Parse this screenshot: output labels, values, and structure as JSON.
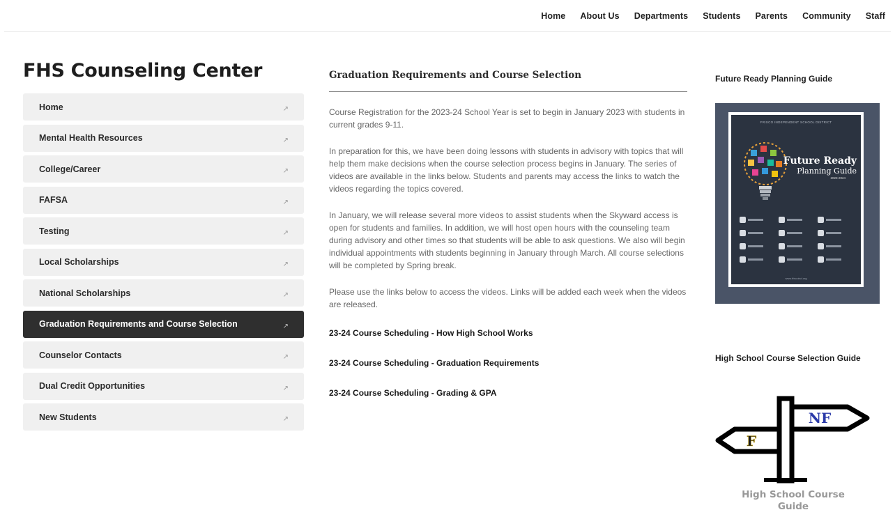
{
  "nav": {
    "items": [
      "Home",
      "About Us",
      "Departments",
      "Students",
      "Parents",
      "Community",
      "Staff"
    ]
  },
  "site": {
    "title": "FHS Counseling Center"
  },
  "sidebar": {
    "active_index": 7,
    "arrow_glyph": "↗",
    "items": [
      {
        "label": "Home"
      },
      {
        "label": "Mental Health Resources"
      },
      {
        "label": "College/Career"
      },
      {
        "label": "FAFSA"
      },
      {
        "label": "Testing"
      },
      {
        "label": "Local Scholarships"
      },
      {
        "label": "National Scholarships"
      },
      {
        "label": "Graduation Requirements and Course Selection"
      },
      {
        "label": "Counselor Contacts"
      },
      {
        "label": "Dual Credit Opportunities"
      },
      {
        "label": "New Students"
      }
    ]
  },
  "main": {
    "heading": "Graduation Requirements and Course Selection",
    "paragraphs": [
      "Course Registration for the 2023-24 School Year is set to begin in January 2023 with students in current grades 9-11.",
      "In preparation for this, we have been doing lessons with students in advisory with topics that will help them make decisions when the course selection process begins in January.  The series of videos are available in the links below.  Students and parents may access the links to watch the videos regarding the topics covered.",
      "In January, we will release several more videos to assist students when the Skyward access is open for students and families.  In addition, we will host open hours with the counseling team during advisory and other times so that students will be able to ask questions.  We also will begin individual appointments with students beginning in January through March.  All course selections will be completed by Spring break.",
      "Please use the links below to access the videos.  Links will be added each week when the videos are released."
    ],
    "links": [
      "23-24 Course Scheduling - How High School Works",
      "23-24 Course Scheduling - Graduation Requirements",
      "23-24 Course Scheduling - Grading & GPA"
    ]
  },
  "right": {
    "future_ready": {
      "heading": "Future Ready Planning Guide",
      "cover": {
        "district": "FRISCO INDEPENDENT SCHOOL DISTRICT",
        "title_line1": "Future Ready",
        "title_line2": "Planning Guide",
        "years": "2023-2024",
        "footer": "www.friscoisd.org"
      }
    },
    "course_guide": {
      "heading": "High School Course Selection Guide",
      "sign_left": "F",
      "sign_right": "NF",
      "caption_line1": "High School Course",
      "caption_line2": "Guide"
    }
  },
  "colors": {
    "active_bg": "#2f2f2f",
    "item_bg": "#f0f0f0",
    "guide_frame": "#4a5467"
  }
}
